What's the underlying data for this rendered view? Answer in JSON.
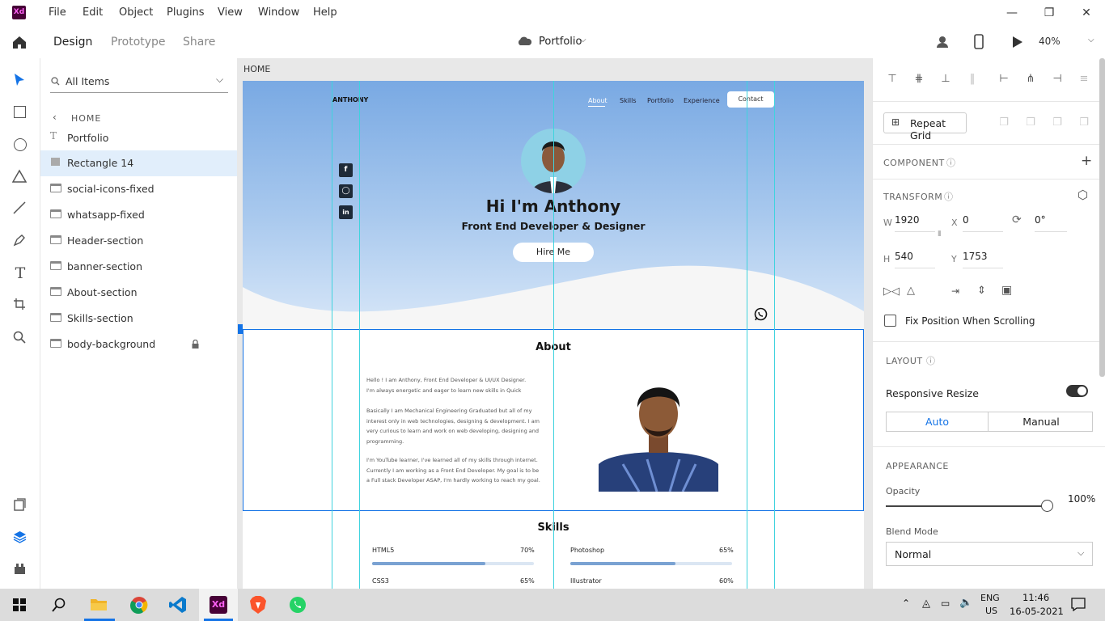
{
  "menu": [
    "File",
    "Edit",
    "Object",
    "Plugins",
    "View",
    "Window",
    "Help"
  ],
  "app_logo": "Xd",
  "modes": {
    "design": "Design",
    "prototype": "Prototype",
    "share": "Share"
  },
  "doc_title": "Portfolio",
  "zoom": "40%",
  "layers": {
    "search_placeholder": "All Items",
    "breadcrumb": "HOME",
    "items": [
      "Portfolio",
      "Rectangle 14",
      "social-icons-fixed",
      "whatsapp-fixed",
      "Header-section",
      "banner-section",
      "About-section",
      "Skills-section",
      "body-background"
    ]
  },
  "artboard": {
    "label": "HOME",
    "brand": "ANTHONY",
    "nav": [
      "About",
      "Skills",
      "Portfolio",
      "Experience"
    ],
    "contact": "Contact",
    "headline": "Hi I'm Anthony",
    "subtitle": "Front End Developer & Designer",
    "hire": "Hire Me",
    "about_title": "About",
    "about_p1a": "Hello ! I am Anthony, Front End Developer & UI/UX Designer.",
    "about_p1b": "I'm always energetic and eager to learn new skills in Quick",
    "about_p2a": "Basically I am Mechanical Engineering Graduated but all of my",
    "about_p2b": "interest only in web technologies, designing & development.  I am",
    "about_p2c": "very curious  to learn and work on web developing, designing and",
    "about_p2d": "programming.",
    "about_p3a": "I'm YouTube learner, I've learned all of my skills through internet.",
    "about_p3b": "Currently I am working as a Front End Developer. My goal is to be",
    "about_p3c": "a Full stack Developer ASAP, I'm hardly working to reach my goal.",
    "skills_title": "Skills",
    "skills": [
      {
        "name": "HTML5",
        "pct": "70%",
        "value": 70
      },
      {
        "name": "Photoshop",
        "pct": "65%",
        "value": 65
      },
      {
        "name": "CSS3",
        "pct": "65%",
        "value": 65
      },
      {
        "name": "Illustrator",
        "pct": "60%",
        "value": 60
      }
    ]
  },
  "props": {
    "repeat_grid": "Repeat Grid",
    "component": "COMPONENT",
    "transform": "TRANSFORM",
    "w_lbl": "W",
    "w": "1920",
    "x_lbl": "X",
    "x": "0",
    "rot": "0°",
    "h_lbl": "H",
    "h": "540",
    "y_lbl": "Y",
    "y": "1753",
    "fix_position": "Fix Position When Scrolling",
    "layout": "LAYOUT",
    "responsive_resize": "Responsive Resize",
    "auto": "Auto",
    "manual": "Manual",
    "appearance": "APPEARANCE",
    "opacity_lbl": "Opacity",
    "opacity": "100%",
    "opacity_value": 1.0,
    "blend_lbl": "Blend Mode",
    "blend": "Normal"
  },
  "taskbar": {
    "lang1": "ENG",
    "lang2": "US",
    "time": "11:46",
    "date": "16-05-2021"
  },
  "colors": {
    "accent": "#1473e6",
    "guide": "#3fd3de",
    "hero_top": "#79a9e3"
  }
}
